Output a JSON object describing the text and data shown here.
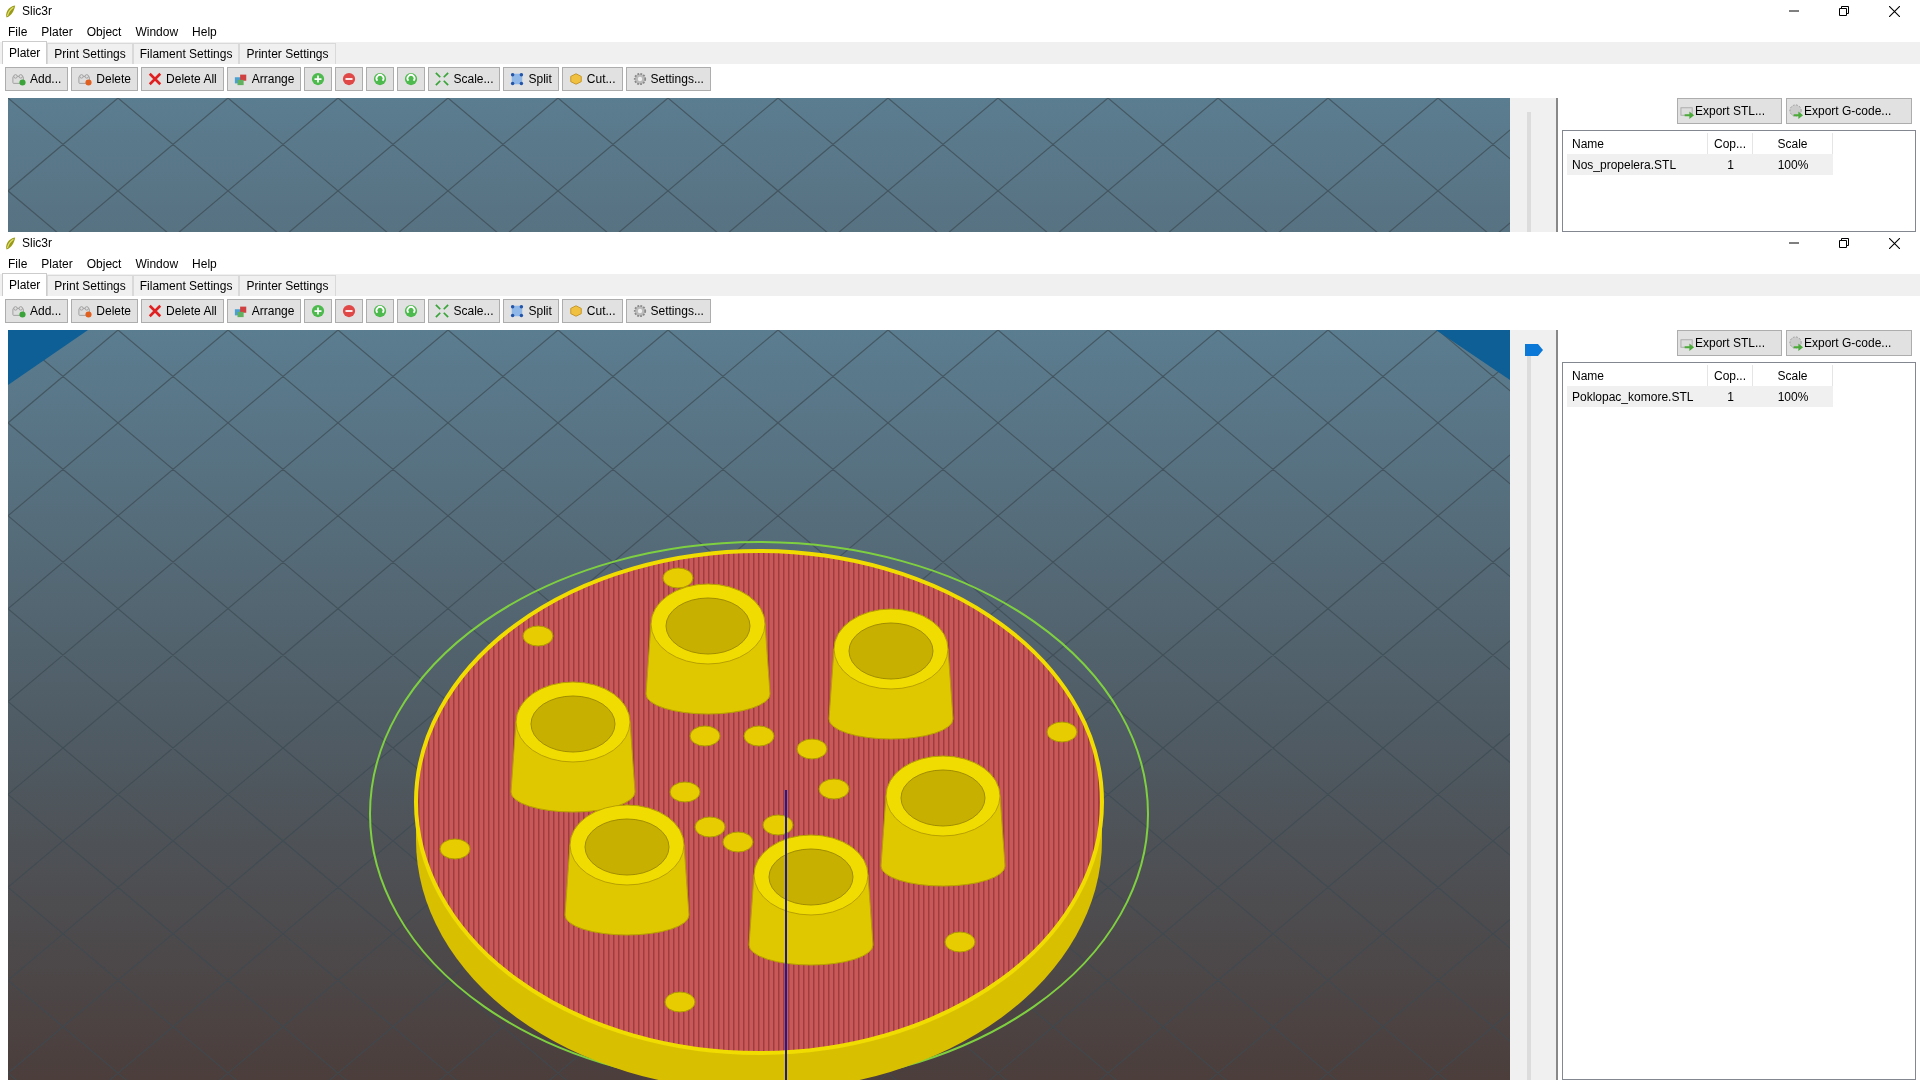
{
  "windows": [
    {
      "title": "Slic3r",
      "menu": [
        "File",
        "Plater",
        "Object",
        "Window",
        "Help"
      ],
      "tabs": [
        {
          "label": "Plater",
          "selected": true
        },
        {
          "label": "Print Settings",
          "selected": false
        },
        {
          "label": "Filament Settings",
          "selected": false
        },
        {
          "label": "Printer Settings",
          "selected": false
        }
      ],
      "toolbar": [
        {
          "kind": "text",
          "label": "Add..."
        },
        {
          "kind": "text",
          "label": "Delete"
        },
        {
          "kind": "text",
          "label": "Delete All"
        },
        {
          "kind": "text",
          "label": "Arrange"
        },
        {
          "kind": "icon"
        },
        {
          "kind": "icon"
        },
        {
          "kind": "icon"
        },
        {
          "kind": "icon"
        },
        {
          "kind": "text",
          "label": "Scale..."
        },
        {
          "kind": "text",
          "label": "Split"
        },
        {
          "kind": "text",
          "label": "Cut..."
        },
        {
          "kind": "text",
          "label": "Settings..."
        }
      ],
      "export_buttons": [
        "Export STL...",
        "Export G-code..."
      ],
      "table": {
        "columns": [
          "Name",
          "Cop...",
          "Scale"
        ],
        "rows": [
          [
            "Nos_propelera.STL",
            "1",
            "100%"
          ]
        ]
      }
    },
    {
      "title": "Slic3r",
      "menu": [
        "File",
        "Plater",
        "Object",
        "Window",
        "Help"
      ],
      "tabs": [
        {
          "label": "Plater",
          "selected": true
        },
        {
          "label": "Print Settings",
          "selected": false
        },
        {
          "label": "Filament Settings",
          "selected": false
        },
        {
          "label": "Printer Settings",
          "selected": false
        }
      ],
      "toolbar": [
        {
          "kind": "text",
          "label": "Add..."
        },
        {
          "kind": "text",
          "label": "Delete"
        },
        {
          "kind": "text",
          "label": "Delete All"
        },
        {
          "kind": "text",
          "label": "Arrange"
        },
        {
          "kind": "icon"
        },
        {
          "kind": "icon"
        },
        {
          "kind": "icon"
        },
        {
          "kind": "icon"
        },
        {
          "kind": "text",
          "label": "Scale..."
        },
        {
          "kind": "text",
          "label": "Split"
        },
        {
          "kind": "text",
          "label": "Cut..."
        },
        {
          "kind": "text",
          "label": "Settings..."
        }
      ],
      "layer_slider": {
        "level": 1
      },
      "export_buttons": [
        "Export STL...",
        "Export G-code..."
      ],
      "table": {
        "columns": [
          "Name",
          "Cop...",
          "Scale"
        ],
        "rows": [
          [
            "Poklopac_komore.STL",
            "1",
            "100%"
          ]
        ]
      }
    }
  ]
}
